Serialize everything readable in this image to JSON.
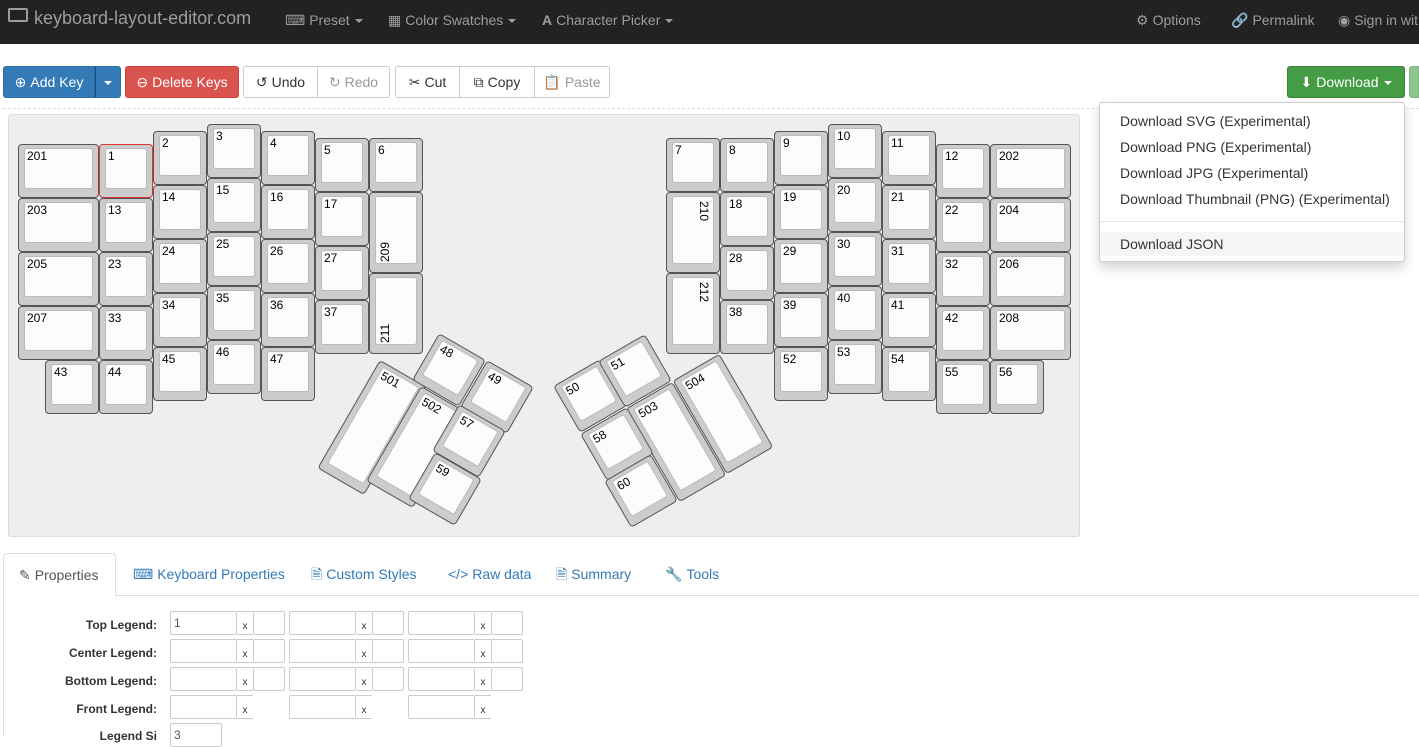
{
  "navbar": {
    "brand": "keyboard-layout-editor.com",
    "menus": [
      {
        "label": "Preset",
        "icon": "keyboard-icon"
      },
      {
        "label": "Color Swatches",
        "icon": "grid-icon"
      },
      {
        "label": "Character Picker",
        "icon": "font-icon"
      }
    ],
    "options": "Options",
    "permalink": "Permalink",
    "signin": "Sign in wit"
  },
  "toolbar": {
    "add_key": "Add Key",
    "delete_keys": "Delete Keys",
    "undo": "Undo",
    "redo": "Redo",
    "cut": "Cut",
    "copy": "Copy",
    "paste": "Paste",
    "download": "Download"
  },
  "download_menu": {
    "items": [
      "Download SVG (Experimental)",
      "Download PNG (Experimental)",
      "Download JPG (Experimental)",
      "Download Thumbnail (PNG) (Experimental)",
      "Download JSON"
    ]
  },
  "keys": [
    "201",
    "1",
    "2",
    "3",
    "4",
    "5",
    "6",
    "203",
    "13",
    "14",
    "15",
    "16",
    "17",
    "209",
    "205",
    "23",
    "24",
    "25",
    "26",
    "27",
    "207",
    "33",
    "34",
    "35",
    "36",
    "37",
    "211",
    "43",
    "44",
    "45",
    "46",
    "47",
    "7",
    "8",
    "9",
    "10",
    "11",
    "12",
    "202",
    "210",
    "18",
    "19",
    "20",
    "21",
    "22",
    "204",
    "28",
    "29",
    "30",
    "31",
    "32",
    "206",
    "212",
    "38",
    "39",
    "40",
    "41",
    "42",
    "208",
    "52",
    "53",
    "54",
    "55",
    "56",
    "501",
    "502",
    "48",
    "49",
    "57",
    "59",
    "50",
    "51",
    "503",
    "504",
    "58",
    "60"
  ],
  "tabs": [
    "Properties",
    "Keyboard Properties",
    "Custom Styles",
    "Raw data",
    "Summary",
    "Tools"
  ],
  "properties": {
    "rows": [
      "Top Legend:",
      "Center Legend:",
      "Bottom Legend:",
      "Front Legend:",
      "Legend Si"
    ],
    "top_legend_value": "1",
    "legend_size_value": "3",
    "x_mark": "x"
  },
  "colors": {
    "navbar": "#222222",
    "primary": "#337ab7",
    "danger": "#d9534f",
    "success": "#449d44"
  }
}
